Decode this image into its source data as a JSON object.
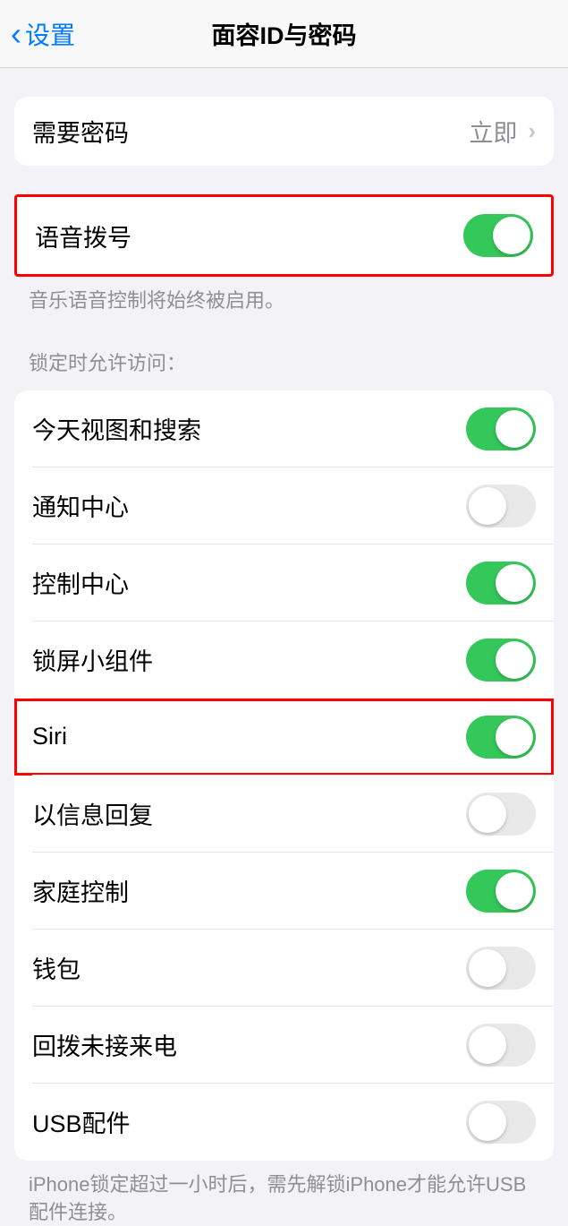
{
  "header": {
    "back_label": "设置",
    "title": "面容ID与密码"
  },
  "passcode": {
    "label": "需要密码",
    "value": "立即"
  },
  "voice_dial": {
    "label": "语音拨号",
    "on": true,
    "footer": "音乐语音控制将始终被启用。"
  },
  "lock_section": {
    "header": "锁定时允许访问：",
    "items": [
      {
        "label": "今天视图和搜索",
        "on": true
      },
      {
        "label": "通知中心",
        "on": false
      },
      {
        "label": "控制中心",
        "on": true
      },
      {
        "label": "锁屏小组件",
        "on": true
      },
      {
        "label": "Siri",
        "on": true
      },
      {
        "label": "以信息回复",
        "on": false
      },
      {
        "label": "家庭控制",
        "on": true
      },
      {
        "label": "钱包",
        "on": false
      },
      {
        "label": "回拨未接来电",
        "on": false
      },
      {
        "label": "USB配件",
        "on": false
      }
    ],
    "footer": "iPhone锁定超过一小时后，需先解锁iPhone才能允许USB配件连接。"
  }
}
